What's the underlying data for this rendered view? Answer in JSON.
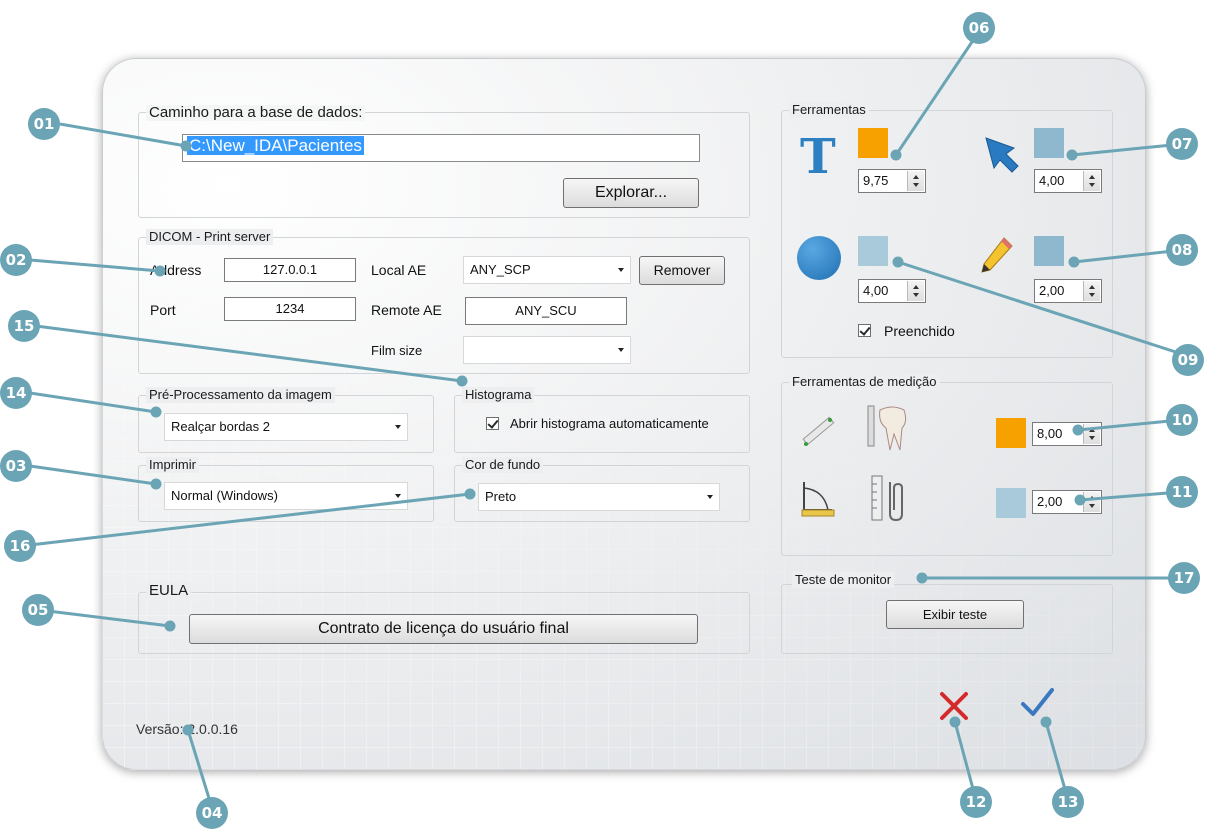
{
  "db": {
    "legend": "Caminho para a base de dados:",
    "path": "C:\\New_IDA\\Pacientes",
    "browse": "Explorar..."
  },
  "dicom": {
    "legend": "DICOM - Print server",
    "address_label": "Address",
    "address": "127.0.0.1",
    "port_label": "Port",
    "port": "1234",
    "local_ae_label": "Local AE",
    "local_ae": "ANY_SCP",
    "remove": "Remover",
    "remote_ae_label": "Remote AE",
    "remote_ae": "ANY_SCU",
    "film_size_label": "Film size",
    "film_size": ""
  },
  "preprocess": {
    "legend": "Pré-Processamento da imagem",
    "value": "Realçar bordas 2"
  },
  "histogram": {
    "legend": "Histograma",
    "auto_open": "Abrir histograma automaticamente",
    "checked": true
  },
  "print": {
    "legend": "Imprimir",
    "value": "Normal (Windows)"
  },
  "background_color": {
    "legend": "Cor de fundo",
    "value": "Preto"
  },
  "eula": {
    "legend": "EULA",
    "button": "Contrato de licença do usuário final"
  },
  "version": "Versão: 2.0.0.16",
  "tools": {
    "legend": "Ferramentas",
    "text_size": "9,75",
    "arrow_size": "4,00",
    "circle_size": "4,00",
    "pencil_size": "2,00",
    "filled_label": "Preenchido",
    "filled": true,
    "colors": {
      "text": "#f7a100",
      "arrow": "#8fb8cf",
      "circle": "#a8cadb",
      "pencil": "#8fb8cf"
    }
  },
  "measure_tools": {
    "legend": "Ferramentas de medição",
    "size_1": "8,00",
    "size_2": "2,00",
    "colors": {
      "first": "#f7a100",
      "second": "#a8cadb"
    }
  },
  "monitor_test": {
    "legend": "Teste de monitor",
    "button": "Exibir teste"
  },
  "callouts": [
    "01",
    "02",
    "03",
    "04",
    "05",
    "06",
    "07",
    "08",
    "09",
    "10",
    "11",
    "12",
    "13",
    "14",
    "15",
    "16",
    "17"
  ],
  "colors": {
    "callout": "#6ba5b5",
    "cancel": "#d42a2a",
    "ok": "#3a78c0",
    "selection": "#3399ff"
  }
}
